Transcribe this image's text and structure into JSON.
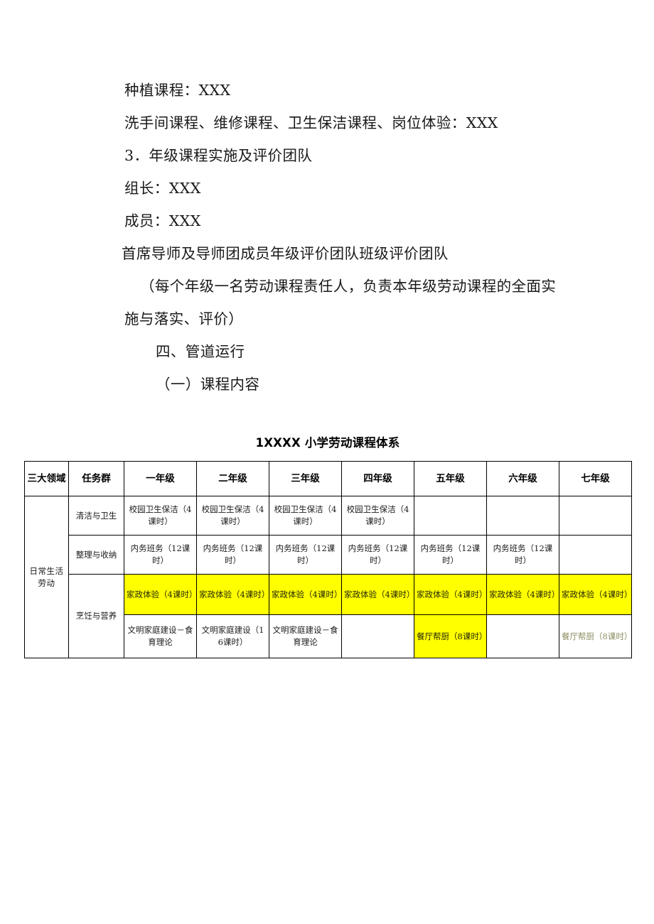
{
  "document": {
    "paragraphs": [
      {
        "text": "种植课程：XXX",
        "indent": "indent1"
      },
      {
        "text": "洗手间课程、维修课程、卫生保洁课程、岗位体验：XXX",
        "indent": "indent1"
      },
      {
        "text": "3．年级课程实施及评价团队",
        "indent": "indent1"
      },
      {
        "text": "组长：XXX",
        "indent": "indent1"
      },
      {
        "text": "成员：XXX",
        "indent": "indent1"
      },
      {
        "text": "首席导师及导师团成员年级评价团队班级评价团队",
        "indent": "indent1"
      },
      {
        "text": "（每个年级一名劳动课程责任人，负责本年级劳动课程的全面实施与落实、评价）",
        "indent": "indent2"
      },
      {
        "text": "四、管道运行",
        "indent": "indent3"
      },
      {
        "text": "（一）课程内容",
        "indent": "indent3"
      }
    ],
    "line_1": "种植课程：XXX",
    "line_2": "洗手间课程、维修课程、卫生保洁课程、岗位体验：XXX",
    "line_3": "3．年级课程实施及评价团队",
    "line_4": "组长：XXX",
    "line_5": "成员：XXX",
    "line_6": "首席导师及导师团成员年级评价团队班级评价团队",
    "line_7": "（每个年级一名劳动课程责任人，负责本年级劳动课程的全面实施与落实、评价）",
    "line_8": "四、管道运行",
    "line_9": "（一）课程内容"
  },
  "table": {
    "title": "1XXXX 小学劳动课程体系",
    "highlight_color": "#ffff00",
    "headers": {
      "domain": "三大领域",
      "task_group": "任务群",
      "grades": [
        "一年级",
        "二年级",
        "三年级",
        "四年级",
        "五年级",
        "六年级",
        "七年级"
      ]
    },
    "domain_label": "日常生活劳动",
    "task_groups": {
      "cleaning": "清洁与卫生",
      "organizing": "整理与收纳",
      "cooking": "烹饪与营养"
    },
    "rows": {
      "cleaning": {
        "g1": "校园卫生保洁（4课时）",
        "g2": "校园卫生保洁（4课时）",
        "g3": "校园卫生保洁（4课时）",
        "g4": "校园卫生保洁（4课时）",
        "g5": "",
        "g6": "",
        "g7": ""
      },
      "organizing": {
        "g1": "内务班务（12课时）",
        "g2": "内务班务（12课时）",
        "g3": "内务班务（12课时）",
        "g4": "内务班务（12课时）",
        "g5": "内务班务（12课时）",
        "g6": "内务班务（12课时）",
        "g7": ""
      },
      "housekeeping": {
        "g1": "家政体验（4课时）",
        "g2": "家政体验（4课时）",
        "g3": "家政体验（4课时）",
        "g4": "家政体验（4课时）",
        "g5": "家政体验（4课时）",
        "g6": "家政体验（4课时）",
        "g7": "家政体验（4课时）"
      },
      "family": {
        "g1": "文明家庭建设－食育理论",
        "g2": "文明家庭建设（16课时）",
        "g3": "文明家庭建设－食育理论",
        "g4": "",
        "g5": "餐厅帮厨（8课时）",
        "g6": "",
        "g7": "餐厅帮厨（8课时）"
      }
    }
  }
}
